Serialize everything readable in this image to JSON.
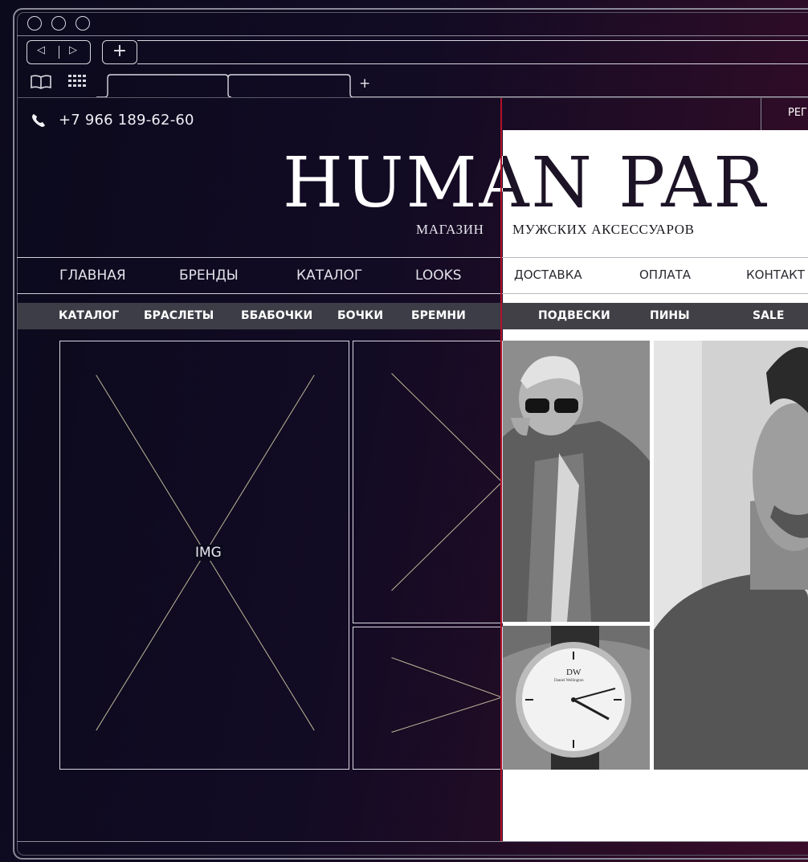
{
  "browser": {
    "back_glyph": "◁",
    "forward_glyph": "▷",
    "new_tab_glyph": "+",
    "tab_add_glyph": "+"
  },
  "header": {
    "phone": "+7 966 189-62-60",
    "brand_name": "HUMAN PAR",
    "tagline_left": "МАГАЗИН",
    "tagline_right": "МУЖСКИХ АКСЕССУАРОВ",
    "register_link": "РЕГ"
  },
  "main_menu": {
    "left": [
      "ГЛАВНАЯ",
      "БРЕНДЫ",
      "КАТАЛОГ",
      "LOOKS"
    ],
    "right": [
      "ДОСТАВКА",
      "ОПЛАТА",
      "КОНТАКТ"
    ]
  },
  "category_menu": {
    "left": [
      "КАТАЛОГ",
      "БРАСЛЕТЫ",
      "ББАБОЧКИ",
      "БОЧКИ",
      "БРЕМНИ"
    ],
    "right": [
      "ПОДВЕСКИ",
      "ПИНЫ",
      "SALE"
    ]
  },
  "placeholder": {
    "label": "IMG"
  },
  "watch": {
    "logo": "DW",
    "sub": "Daniel Wellington"
  },
  "icons": {
    "phone": "phone-icon",
    "book": "book-icon",
    "grid": "grid-icon",
    "window_dots": "window-control-icon"
  },
  "colors": {
    "background": "#0b0a1c",
    "accent_line": "#b0122a",
    "category_bar": "#3d3d47",
    "wire": "#d8d8e0"
  }
}
